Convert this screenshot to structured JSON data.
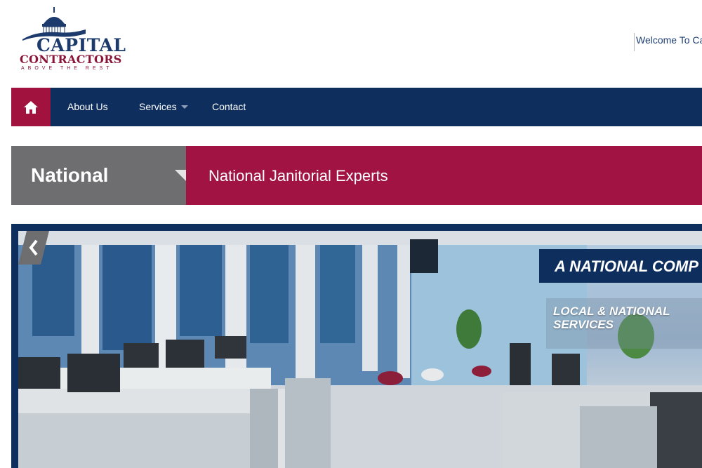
{
  "header": {
    "logo": {
      "line1": "CAPITAL",
      "line2": "CONTRACTORS",
      "tagline": "ABOVE THE REST"
    },
    "welcome_text": "Welcome To Cap"
  },
  "nav": {
    "home_icon": "home-icon",
    "items": [
      {
        "label": "About Us"
      },
      {
        "label": "Services"
      },
      {
        "label": "Contact"
      }
    ]
  },
  "banner": {
    "title": "National",
    "subtitle": "National Janitorial Experts"
  },
  "hero": {
    "slide_heading": "A NATIONAL COMP",
    "slide_text": "LOCAL & NATIONAL SERVICES",
    "prev_icon": "chevron-left-icon"
  },
  "colors": {
    "navy": "#0e2f5e",
    "crimson": "#a2123e",
    "gray": "#6e6e70"
  }
}
